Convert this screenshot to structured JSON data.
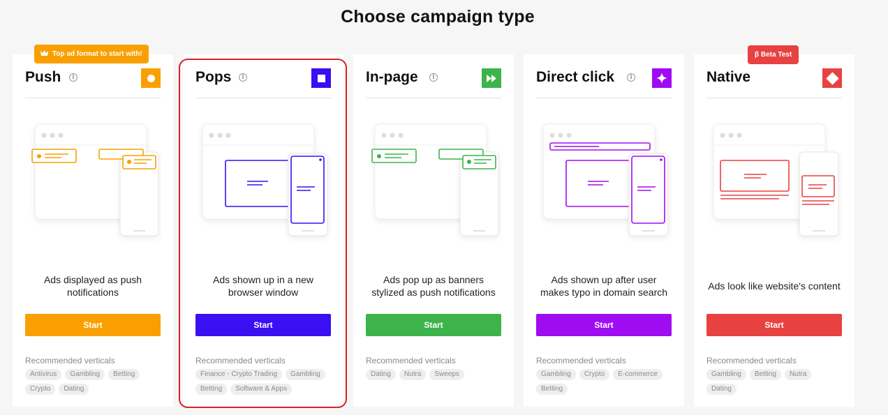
{
  "page": {
    "title": "Choose campaign type"
  },
  "recommended_label": "Recommended verticals",
  "cards": [
    {
      "id": "push",
      "title": "Push",
      "color": "#f9a000",
      "icon": "circle-icon",
      "badge": "Top ad format to start with!",
      "badge_color": "#f9a000",
      "description": "Ads displayed as push notifications",
      "start_label": "Start",
      "verticals": [
        "Antivirus",
        "Gambling",
        "Betting",
        "Crypto",
        "Dating"
      ]
    },
    {
      "id": "pops",
      "title": "Pops",
      "color": "#3a0ff2",
      "icon": "square-icon",
      "description": "Ads shown up in a new browser window",
      "start_label": "Start",
      "selected": true,
      "verticals": [
        "Finance - Crypto Trading",
        "Gambling",
        "Betting",
        "Software & Apps"
      ]
    },
    {
      "id": "inpage",
      "title": "In-page",
      "color": "#3cb44a",
      "icon": "fast-forward-icon",
      "description": "Ads pop up as banners stylized as push notifications",
      "start_label": "Start",
      "verticals": [
        "Dating",
        "Nutra",
        "Sweeps"
      ]
    },
    {
      "id": "directclick",
      "title": "Direct click",
      "color": "#a00cf2",
      "icon": "sparkle-icon",
      "description": "Ads shown up after user makes typo in domain search",
      "start_label": "Start",
      "verticals": [
        "Gambling",
        "Crypto",
        "E-commerce",
        "Betting"
      ]
    },
    {
      "id": "native",
      "title": "Native",
      "color": "#e84141",
      "icon": "diamond-icon",
      "badge": "β Beta Test",
      "badge_color": "#e84141",
      "description": "Ads look like website's content",
      "start_label": "Start",
      "verticals": [
        "Gambling",
        "Betting",
        "Nutra",
        "Dating"
      ]
    }
  ]
}
